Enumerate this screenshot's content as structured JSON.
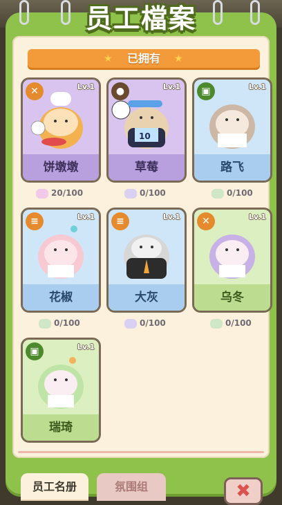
{
  "header": {
    "title": "员工檔案"
  },
  "ribbon": {
    "label": "已拥有"
  },
  "cards": [
    {
      "name": "饼墩墩",
      "level": "Lv.1",
      "shards": "20/100",
      "badge_icon": "utensils-icon",
      "theme": "purple"
    },
    {
      "name": "草莓",
      "level": "Lv.1",
      "shards": "0/100",
      "badge_icon": "ball-icon",
      "theme": "purple"
    },
    {
      "name": "路飞",
      "level": "Lv.1",
      "shards": "0/100",
      "badge_icon": "cart-icon",
      "theme": "blue"
    },
    {
      "name": "花椒",
      "level": "Lv.1",
      "shards": "0/100",
      "badge_icon": "dumbbell-icon",
      "theme": "blue"
    },
    {
      "name": "大灰",
      "level": "Lv.1",
      "shards": "0/100",
      "badge_icon": "dumbbell-icon",
      "theme": "blue"
    },
    {
      "name": "乌冬",
      "level": "Lv.1",
      "shards": "0/100",
      "badge_icon": "utensils-icon",
      "theme": "green"
    },
    {
      "name": "瑞琦",
      "level": "Lv.1",
      "shards": "",
      "badge_icon": "cart-icon",
      "theme": "green"
    }
  ],
  "tabs": [
    {
      "label": "员工名册",
      "active": true
    },
    {
      "label": "氛围组",
      "active": false
    }
  ],
  "colors": {
    "panel": "#8fc24a",
    "ribbon": "#f39b3a",
    "purple_card": "#d9c4ef",
    "blue_card": "#cfe6f8",
    "green_card": "#dcefc0"
  }
}
